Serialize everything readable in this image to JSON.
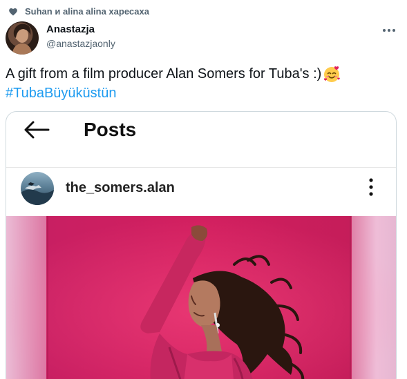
{
  "social_context": {
    "icon": "heart-icon",
    "text": "Suhan и alina alina харесаха"
  },
  "author": {
    "name": "Anastazja",
    "handle": "@anastazjaonly"
  },
  "tweet": {
    "text": "A gift from a film producer Alan Somers for Tuba's :)",
    "emoji": "smiling-face-with-hearts-icon",
    "hashtag": "#TubaBüyüküstün"
  },
  "embedded_post": {
    "back_icon": "arrow-left-icon",
    "title": "Posts",
    "username": "the_somers.alan",
    "more_icon": "vertical-ellipsis-icon"
  },
  "colors": {
    "link": "#1d9bf0",
    "secondary_text": "#536471",
    "photo_backdrop": "#d8215f"
  }
}
